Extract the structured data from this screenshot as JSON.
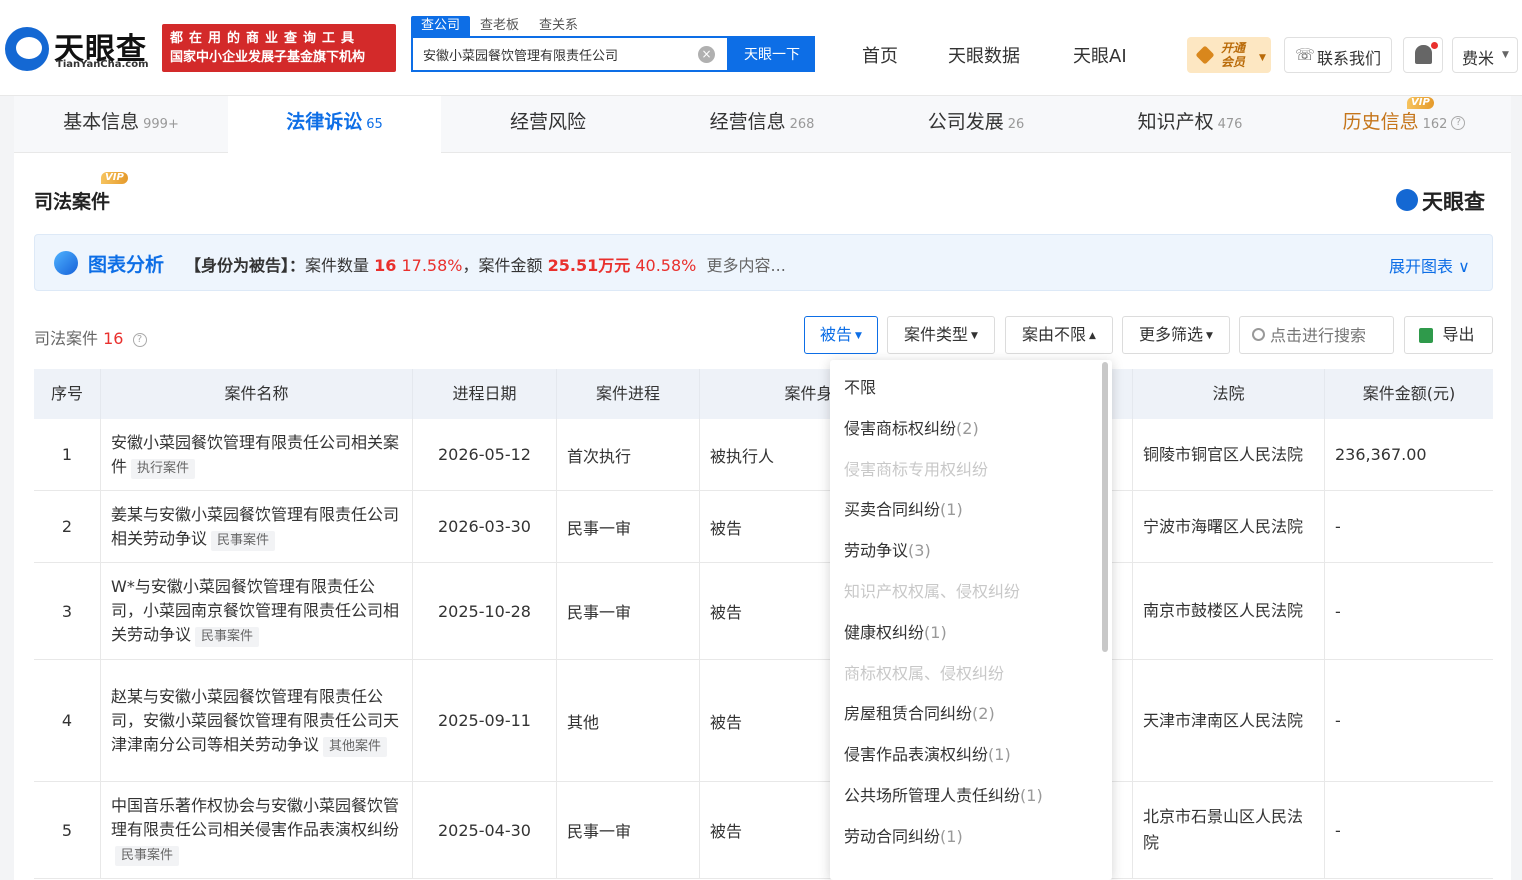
{
  "header": {
    "logo_cn": "天眼查",
    "logo_en": "TianYanCha.com",
    "slogan_line1": "都在用的商业查询工具",
    "slogan_line2": "国家中小企业发展子基金旗下机构",
    "search_tabs": [
      "查公司",
      "查老板",
      "查关系"
    ],
    "search_value": "安徽小菜园餐饮管理有限责任公司",
    "search_button": "天眼一下",
    "nav": [
      "首页",
      "天眼数据",
      "天眼AI"
    ],
    "vip_line1": "开通",
    "vip_line2": "会员",
    "contact": "联系我们",
    "user": "费米"
  },
  "tabs": [
    {
      "label": "基本信息",
      "count": "999+"
    },
    {
      "label": "法律诉讼",
      "count": "65"
    },
    {
      "label": "经营风险",
      "count": ""
    },
    {
      "label": "经营信息",
      "count": "268"
    },
    {
      "label": "公司发展",
      "count": "26"
    },
    {
      "label": "知识产权",
      "count": "476"
    },
    {
      "label": "历史信息",
      "count": "162"
    }
  ],
  "vip_badge": "VIP",
  "section": {
    "title": "司法案件",
    "brand": "天眼查"
  },
  "analysis": {
    "title": "图表分析",
    "prefix": "【身份为被告】：",
    "count_label": "案件数量",
    "count": "16",
    "count_pct": "17.58%",
    "amount_label": "，案件金额",
    "amount": "25.51万元",
    "amount_pct": "40.58%",
    "more": "更多内容...",
    "expand": "展开图表"
  },
  "list": {
    "label": "司法案件",
    "count": "16"
  },
  "filters": {
    "role": "被告",
    "case_type": "案件类型",
    "cause": "案由不限",
    "more": "更多筛选",
    "search_placeholder": "点击进行搜索",
    "export": "导出"
  },
  "table": {
    "headers": [
      "序号",
      "案件名称",
      "进程日期",
      "案件进程",
      "案件身份",
      "法院",
      "案件金额(元)"
    ],
    "rows": [
      {
        "no": "1",
        "name": "安徽小菜园餐饮管理有限责任公司相关案件",
        "tag": "执行案件",
        "date": "2026-05-12",
        "stage": "首次执行",
        "role": "被执行人",
        "court": "铜陵市铜官区人民法院",
        "amount": "236,367.00"
      },
      {
        "no": "2",
        "name": "姜某与安徽小菜园餐饮管理有限责任公司相关劳动争议",
        "tag": "民事案件",
        "date": "2026-03-30",
        "stage": "民事一审",
        "role": "被告",
        "court": "宁波市海曙区人民法院",
        "amount": "-"
      },
      {
        "no": "3",
        "name": "W*与安徽小菜园餐饮管理有限责任公司，小菜园南京餐饮管理有限责任公司相关劳动争议",
        "tag": "民事案件",
        "date": "2025-10-28",
        "stage": "民事一审",
        "role": "被告",
        "court": "南京市鼓楼区人民法院",
        "amount": "-"
      },
      {
        "no": "4",
        "name": "赵某与安徽小菜园餐饮管理有限责任公司，安徽小菜园餐饮管理有限责任公司天津津南分公司等相关劳动争议",
        "tag": "其他案件",
        "date": "2025-09-11",
        "stage": "其他",
        "role": "被告",
        "court": "天津市津南区人民法院",
        "amount": "-"
      },
      {
        "no": "5",
        "name": "中国音乐著作权协会与安徽小菜园餐饮管理有限责任公司相关侵害作品表演权纠纷",
        "tag": "民事案件",
        "date": "2025-04-30",
        "stage": "民事一审",
        "role": "被告",
        "court": "北京市石景山区人民法院",
        "amount": "-"
      }
    ]
  },
  "dropdown": {
    "items": [
      {
        "label": "不限",
        "count": "",
        "disabled": false
      },
      {
        "label": "侵害商标权纠纷",
        "count": "(2)",
        "disabled": false
      },
      {
        "label": "侵害商标专用权纠纷",
        "count": "",
        "disabled": true
      },
      {
        "label": "买卖合同纠纷",
        "count": "(1)",
        "disabled": false
      },
      {
        "label": "劳动争议",
        "count": "(3)",
        "disabled": false
      },
      {
        "label": "知识产权权属、侵权纠纷",
        "count": "",
        "disabled": true
      },
      {
        "label": "健康权纠纷",
        "count": "(1)",
        "disabled": false
      },
      {
        "label": "商标权权属、侵权纠纷",
        "count": "",
        "disabled": true
      },
      {
        "label": "房屋租赁合同纠纷",
        "count": "(2)",
        "disabled": false
      },
      {
        "label": "侵害作品表演权纠纷",
        "count": "(1)",
        "disabled": false
      },
      {
        "label": "公共场所管理人责任纠纷",
        "count": "(1)",
        "disabled": false
      },
      {
        "label": "劳动合同纠纷",
        "count": "(1)",
        "disabled": false
      }
    ]
  },
  "colors": {
    "accent": "#0d6ee6",
    "danger": "#e9302d",
    "brand_red": "#d32a2a",
    "vip_gold": "#c5751a"
  },
  "icons": [
    "logo-icon",
    "clear-icon",
    "diamond-icon",
    "phone-icon",
    "bell-icon",
    "help-icon",
    "chart-analysis-icon",
    "chevron-down-icon",
    "search-icon",
    "excel-export-icon"
  ]
}
